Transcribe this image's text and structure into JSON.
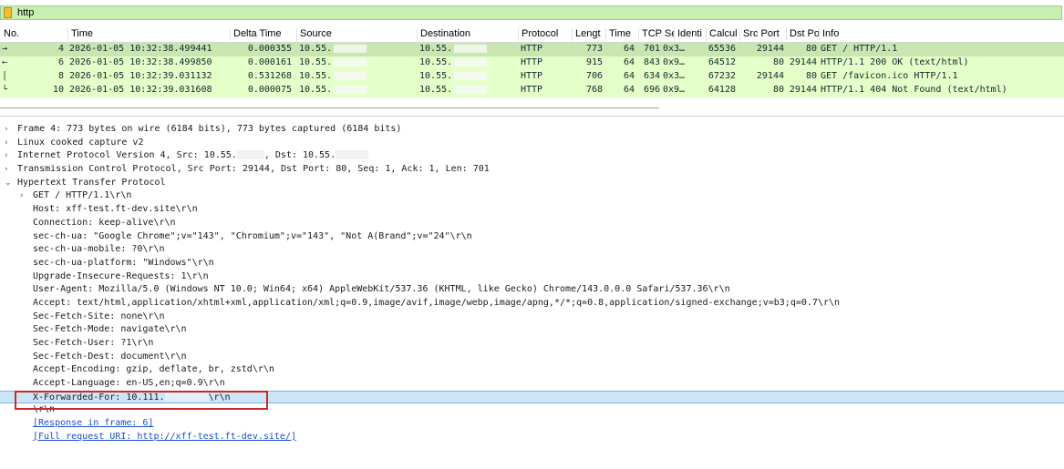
{
  "filter": {
    "value": "http"
  },
  "packet_list": {
    "columns": [
      "No.",
      "Time",
      "Delta Time",
      "Source",
      "Destination",
      "Protocol",
      "Lengt",
      "Time",
      "TCP Se",
      "Identi",
      "Calcul",
      "Src Port",
      "Dst Po",
      "Info"
    ],
    "rows": [
      {
        "no": "4",
        "time": "2026-01-05 10:32:38.499441",
        "delta": "0.000355",
        "source": "10.55.",
        "destination": "10.55.",
        "protocol": "HTTP",
        "length": "773",
        "ttl": "64",
        "tcp_seg": "701",
        "ident": "0x3…",
        "calc": "65536",
        "src_port": "29144",
        "dst_port": "80",
        "info": "GET / HTTP/1.1"
      },
      {
        "no": "6",
        "time": "2026-01-05 10:32:38.499850",
        "delta": "0.000161",
        "source": "10.55.",
        "destination": "10.55.",
        "protocol": "HTTP",
        "length": "915",
        "ttl": "64",
        "tcp_seg": "843",
        "ident": "0x9…",
        "calc": "64512",
        "src_port": "80",
        "dst_port": "29144",
        "info": "HTTP/1.1 200 OK  (text/html)"
      },
      {
        "no": "8",
        "time": "2026-01-05 10:32:39.031132",
        "delta": "0.531268",
        "source": "10.55.",
        "destination": "10.55.",
        "protocol": "HTTP",
        "length": "706",
        "ttl": "64",
        "tcp_seg": "634",
        "ident": "0x3…",
        "calc": "67232",
        "src_port": "29144",
        "dst_port": "80",
        "info": "GET /favicon.ico HTTP/1.1"
      },
      {
        "no": "10",
        "time": "2026-01-05 10:32:39.031608",
        "delta": "0.000075",
        "source": "10.55.",
        "destination": "10.55.",
        "protocol": "HTTP",
        "length": "768",
        "ttl": "64",
        "tcp_seg": "696",
        "ident": "0x9…",
        "calc": "64128",
        "src_port": "80",
        "dst_port": "29144",
        "info": "HTTP/1.1 404 Not Found  (text/html)"
      }
    ]
  },
  "details": {
    "frame": "Frame 4: 773 bytes on wire (6184 bits), 773 bytes captured (6184 bits)",
    "linux": "Linux cooked capture v2",
    "ip_a": "Internet Protocol Version 4, Src: 10.55.",
    "ip_b": ", Dst: 10.55.",
    "tcp": "Transmission Control Protocol, Src Port: 29144, Dst Port: 80, Seq: 1, Ack: 1, Len: 701",
    "http": "Hypertext Transfer Protocol",
    "request_line": "GET / HTTP/1.1\\r\\n",
    "host": "Host: xff-test.ft-dev.site\\r\\n",
    "connection": "Connection: keep-alive\\r\\n",
    "sec_ch_ua": "sec-ch-ua: \"Google Chrome\";v=\"143\", \"Chromium\";v=\"143\", \"Not A(Brand\";v=\"24\"\\r\\n",
    "sec_ch_ua_mobile": "sec-ch-ua-mobile: ?0\\r\\n",
    "sec_ch_ua_platform": "sec-ch-ua-platform: \"Windows\"\\r\\n",
    "upgrade": "Upgrade-Insecure-Requests: 1\\r\\n",
    "user_agent": "User-Agent: Mozilla/5.0 (Windows NT 10.0; Win64; x64) AppleWebKit/537.36 (KHTML, like Gecko) Chrome/143.0.0.0 Safari/537.36\\r\\n",
    "accept": "Accept: text/html,application/xhtml+xml,application/xml;q=0.9,image/avif,image/webp,image/apng,*/*;q=0.8,application/signed-exchange;v=b3;q=0.7\\r\\n",
    "fetch_site": "Sec-Fetch-Site: none\\r\\n",
    "fetch_mode": "Sec-Fetch-Mode: navigate\\r\\n",
    "fetch_user": "Sec-Fetch-User: ?1\\r\\n",
    "fetch_dest": "Sec-Fetch-Dest: document\\r\\n",
    "accept_encoding": "Accept-Encoding: gzip, deflate, br, zstd\\r\\n",
    "accept_language": "Accept-Language: en-US,en;q=0.9\\r\\n",
    "xff_a": "X-Forwarded-For: 10.111.",
    "xff_b": "\\r\\n",
    "crlf": "\\r\\n",
    "response_link": "[Response in frame: 6]",
    "full_uri": "[Full request URI: http://xff-test.ft-dev.site/]"
  },
  "colors": {
    "filter_bg": "#c6efb0",
    "row_bg": "#e4ffc7",
    "selected_row": "#c7e6b0",
    "highlight": "#cde6f7",
    "red_box": "#d0262a",
    "link": "#1a4fd0"
  }
}
